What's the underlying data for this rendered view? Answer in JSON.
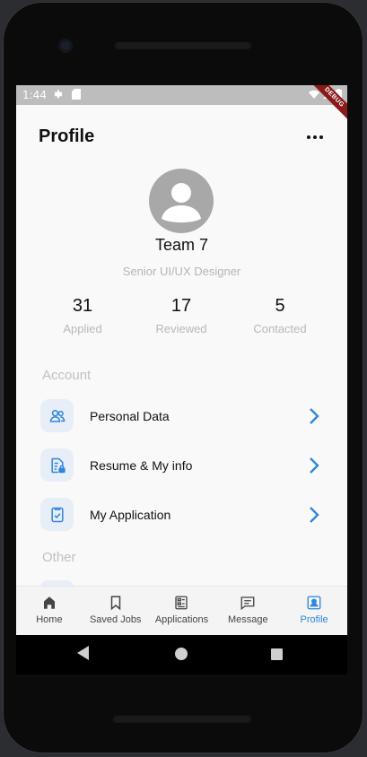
{
  "status_bar": {
    "time": "1:44",
    "debug_label": "DEBUG"
  },
  "header": {
    "title": "Profile"
  },
  "profile": {
    "name": "Team 7",
    "role": "Senior UI/UX Designer"
  },
  "stats": [
    {
      "value": "31",
      "label": "Applied"
    },
    {
      "value": "17",
      "label": "Reviewed"
    },
    {
      "value": "5",
      "label": "Contacted"
    }
  ],
  "account_section": {
    "title": "Account",
    "items": [
      {
        "label": "Personal Data",
        "icon": "people-icon"
      },
      {
        "label": "Resume & My info",
        "icon": "document-lock-icon"
      },
      {
        "label": "My Application",
        "icon": "document-check-icon"
      }
    ]
  },
  "other_section": {
    "title": "Other"
  },
  "bottom_nav": [
    {
      "label": "Home",
      "icon": "home-icon"
    },
    {
      "label": "Saved Jobs",
      "icon": "bookmark-icon"
    },
    {
      "label": "Applications",
      "icon": "applications-icon"
    },
    {
      "label": "Message",
      "icon": "message-icon"
    },
    {
      "label": "Profile",
      "icon": "profile-icon",
      "active": true
    }
  ],
  "colors": {
    "accent": "#2f86dd",
    "icon_bg": "#e8eef8",
    "avatar": "#a8a8a8"
  }
}
